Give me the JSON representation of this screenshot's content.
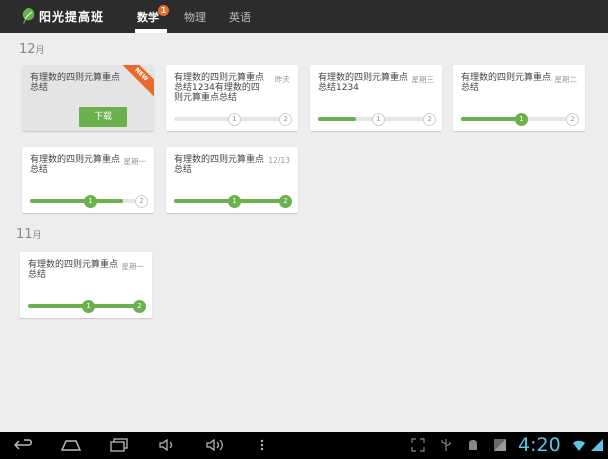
{
  "app": {
    "title": "阳光提高班"
  },
  "tabs": [
    {
      "label": "数学",
      "badge": "1"
    },
    {
      "label": "物理"
    },
    {
      "label": "英语"
    }
  ],
  "sections": [
    {
      "month_num": "12",
      "month_unit": "月",
      "cards": [
        {
          "title": "有理数的四则元算重点总结",
          "date": "",
          "is_new": true,
          "new_label": "NEW",
          "button": "下载"
        },
        {
          "title": "有理数的四则元算重点总结1234有理数的四则元算重点总结",
          "date": "昨天",
          "progress": 0.0,
          "nodes": [
            "1",
            "2"
          ]
        },
        {
          "title": "有理数的四则元算重点总结1234",
          "date": "星期三",
          "progress": 0.33,
          "nodes": [
            "1",
            "2"
          ]
        },
        {
          "title": "有理数的四则元算重点总结",
          "date": "星期二",
          "progress": 0.5,
          "nodes": [
            "1",
            "2"
          ]
        },
        {
          "title": "有理数的四则元算重点总结",
          "date": "星期一",
          "progress": 0.8,
          "nodes": [
            "1",
            "2"
          ]
        },
        {
          "title": "有理数的四则元算重点总结",
          "date": "12/13",
          "progress": 1.0,
          "nodes": [
            "1",
            "2"
          ]
        }
      ]
    },
    {
      "month_num": "11",
      "month_unit": "月",
      "cards": [
        {
          "title": "有理数的四则元算重点总结",
          "date": "星期一",
          "progress": 1.0,
          "nodes": [
            "1",
            "2"
          ]
        }
      ]
    }
  ],
  "status": {
    "time": "4:20"
  },
  "colors": {
    "accent": "#6ab04c",
    "badge": "#e86a2c",
    "bar": "#2c2c2c"
  }
}
